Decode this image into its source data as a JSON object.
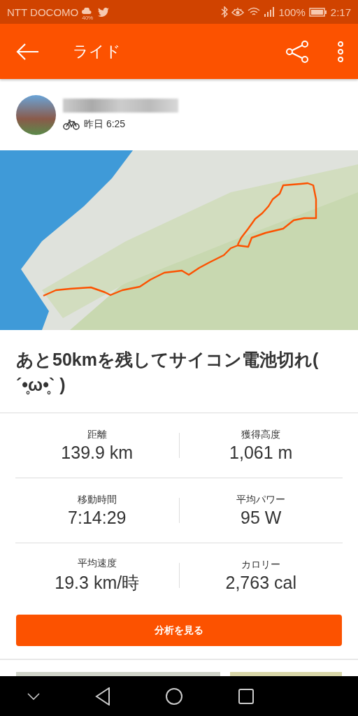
{
  "status_bar": {
    "carrier": "NTT DOCOMO",
    "weather_badge": "40%",
    "battery": "100%",
    "time": "2:17"
  },
  "app_bar": {
    "title": "ライド"
  },
  "activity": {
    "date": "昨日 6:25",
    "title": "あと50kmを残してサイコン電池切れ( ´•̥ω•̥` )"
  },
  "stats": [
    {
      "label": "距離",
      "value": "139.9 km"
    },
    {
      "label": "獲得高度",
      "value": "1,061 m"
    },
    {
      "label": "移動時間",
      "value": "7:14:29"
    },
    {
      "label": "平均パワー",
      "value": "95 W"
    },
    {
      "label": "平均速度",
      "value": "19.3 km/時"
    },
    {
      "label": "カロリー",
      "value": "2,763 cal"
    }
  ],
  "analysis_button": "分析を見る"
}
